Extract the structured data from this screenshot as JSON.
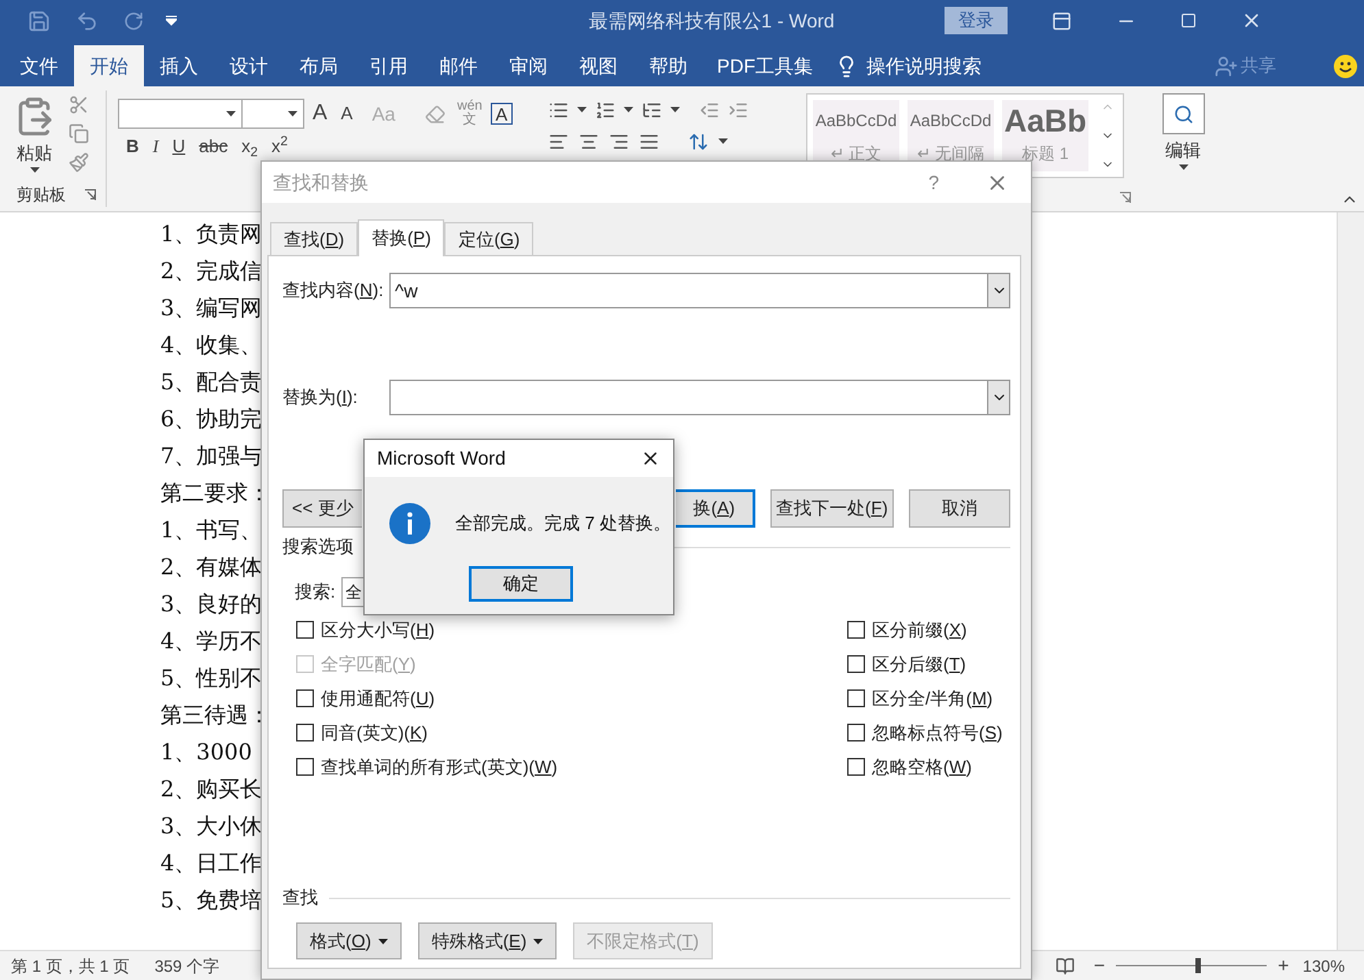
{
  "window": {
    "title": "最需网络科技有限公1 - Word",
    "sign_in": "登录"
  },
  "ribbon_tabs": [
    {
      "label": "文件",
      "selected": false
    },
    {
      "label": "开始",
      "selected": true
    },
    {
      "label": "插入",
      "selected": false
    },
    {
      "label": "设计",
      "selected": false
    },
    {
      "label": "布局",
      "selected": false
    },
    {
      "label": "引用",
      "selected": false
    },
    {
      "label": "邮件",
      "selected": false
    },
    {
      "label": "审阅",
      "selected": false
    },
    {
      "label": "视图",
      "selected": false
    },
    {
      "label": "帮助",
      "selected": false
    },
    {
      "label": "PDF工具集",
      "selected": false
    }
  ],
  "tell_me": "操作说明搜索",
  "share": "共享",
  "ribbon": {
    "paste": "粘贴",
    "clipboard_group": "剪贴板",
    "grow_font": "A",
    "shrink_font": "A",
    "change_case": "Aa",
    "phonetic": "wén",
    "phonetic_char": "文",
    "char_border": "A",
    "font_buttons": [
      {
        "label": "B",
        "kind": "bold"
      },
      {
        "label": "I",
        "kind": "italic"
      },
      {
        "label": "U",
        "kind": "underline"
      },
      {
        "label": "abc",
        "kind": "strike"
      },
      {
        "label": "x$_{2}$",
        "kind": "plain"
      },
      {
        "label": "x$^{2}$",
        "kind": "plain"
      }
    ],
    "styles": [
      {
        "preview": "AaBbCcDd",
        "name": "↵ 正文",
        "kind": "paragraph"
      },
      {
        "preview": "AaBbCcDd",
        "name": "↵ 无间隔",
        "kind": "paragraph"
      },
      {
        "preview": "AaBb",
        "name": "标题 1",
        "kind": "heading"
      }
    ],
    "editing": "编辑"
  },
  "document": {
    "lines": [
      "1、负责网",
      "2、完成信",
      "3、编写网",
      "4、收集、",
      "5、配合责",
      "6、协助完",
      "7、加强与",
      "第二要求：",
      "1、书写、",
      "2、有媒体",
      "3、良好的",
      "4、学历不",
      "5、性别不",
      "第三待遇：",
      "1、3000",
      "2、购买长",
      "3、大小休",
      "4、日工作",
      "5、免费培"
    ]
  },
  "status_bar": {
    "page": "第 1 页，共 1 页",
    "words": "359 个字",
    "zoom_out": "−",
    "zoom_in": "+",
    "zoom": "130%",
    "level": 0.55
  },
  "find_replace": {
    "title": "查找和替换",
    "help": "?",
    "tabs": [
      {
        "label": "查找(D)",
        "selected": false
      },
      {
        "label": "替换(P)",
        "selected": true
      },
      {
        "label": "定位(G)",
        "selected": false
      }
    ],
    "find_label": "查找内容(N):",
    "find_value": "^w",
    "replace_label": "替换为(I):",
    "buttons": [
      {
        "label": "<< 更少",
        "default": false
      },
      {
        "label": "换(A)",
        "default": true
      },
      {
        "label": "查找下一处(F)",
        "default": false
      },
      {
        "label": "取消",
        "default": false
      }
    ],
    "options_title": "搜索选项",
    "search_label": "搜索:",
    "search_value": "全",
    "options_left": [
      {
        "label": "区分大小写(H)",
        "checked": false,
        "disabled": false
      },
      {
        "label": "全字匹配(Y)",
        "checked": false,
        "disabled": true
      },
      {
        "label": "使用通配符(U)",
        "checked": false,
        "disabled": false
      },
      {
        "label": "同音(英文)(K)",
        "checked": false,
        "disabled": false
      },
      {
        "label": "查找单词的所有形式(英文)(W)",
        "checked": false,
        "disabled": false
      }
    ],
    "options_right": [
      {
        "label": "区分前缀(X)",
        "checked": false,
        "disabled": false
      },
      {
        "label": "区分后缀(T)",
        "checked": false,
        "disabled": false
      },
      {
        "label": "区分全/半角(M)",
        "checked": false,
        "disabled": false
      },
      {
        "label": "忽略标点符号(S)",
        "checked": false,
        "disabled": false
      },
      {
        "label": "忽略空格(W)",
        "checked": false,
        "disabled": false
      }
    ],
    "find_section": "查找",
    "format_buttons": [
      {
        "label": "格式(O)",
        "dropdown": true,
        "disabled": false
      },
      {
        "label": "特殊格式(E)",
        "dropdown": true,
        "disabled": false
      },
      {
        "label": "不限定格式(T)",
        "dropdown": false,
        "disabled": true
      }
    ]
  },
  "message_box": {
    "title": "Microsoft Word",
    "message": "全部完成。完成 7 处替换。",
    "ok": "确定"
  }
}
